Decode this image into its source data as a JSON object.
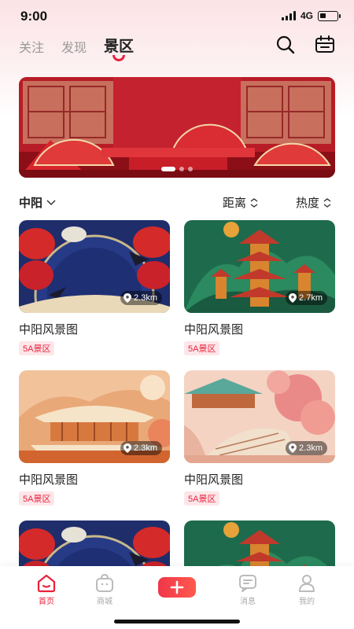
{
  "status": {
    "time": "9:00",
    "network": "4G"
  },
  "tabs": [
    {
      "label": "关注"
    },
    {
      "label": "发现"
    },
    {
      "label": "景区"
    }
  ],
  "active_tab": "景区",
  "banner": {
    "pages": 3,
    "current": 1
  },
  "filters": {
    "city": "中阳",
    "distance": "距离",
    "popularity": "热度"
  },
  "cards": [
    {
      "title": "中阳风景图",
      "tag": "5A景区",
      "distance": "2.3km",
      "image": "lanterns-swallows"
    },
    {
      "title": "中阳风景图",
      "tag": "5A景区",
      "distance": "2.7km",
      "image": "pagoda-green"
    },
    {
      "title": "中阳风景图",
      "tag": "5A景区",
      "distance": "2.3km",
      "image": "palace-orange"
    },
    {
      "title": "中阳风景图",
      "tag": "5A景区",
      "distance": "2.3km",
      "image": "bridge-blossoms"
    },
    {
      "title": "",
      "tag": "",
      "distance": "",
      "image": "lanterns-swallows"
    },
    {
      "title": "",
      "tag": "",
      "distance": "",
      "image": "pagoda-green"
    }
  ],
  "nav": [
    {
      "label": "首页",
      "icon": "home-icon",
      "active": true
    },
    {
      "label": "商城",
      "icon": "shop-icon",
      "active": false
    },
    {
      "label": "",
      "icon": "plus-icon",
      "active": false
    },
    {
      "label": "消息",
      "icon": "message-icon",
      "active": false
    },
    {
      "label": "我的",
      "icon": "user-icon",
      "active": false
    }
  ],
  "colors": {
    "accent": "#e8223d",
    "inactive": "#aaaaaa",
    "top_tint": "#fbe3e6"
  }
}
